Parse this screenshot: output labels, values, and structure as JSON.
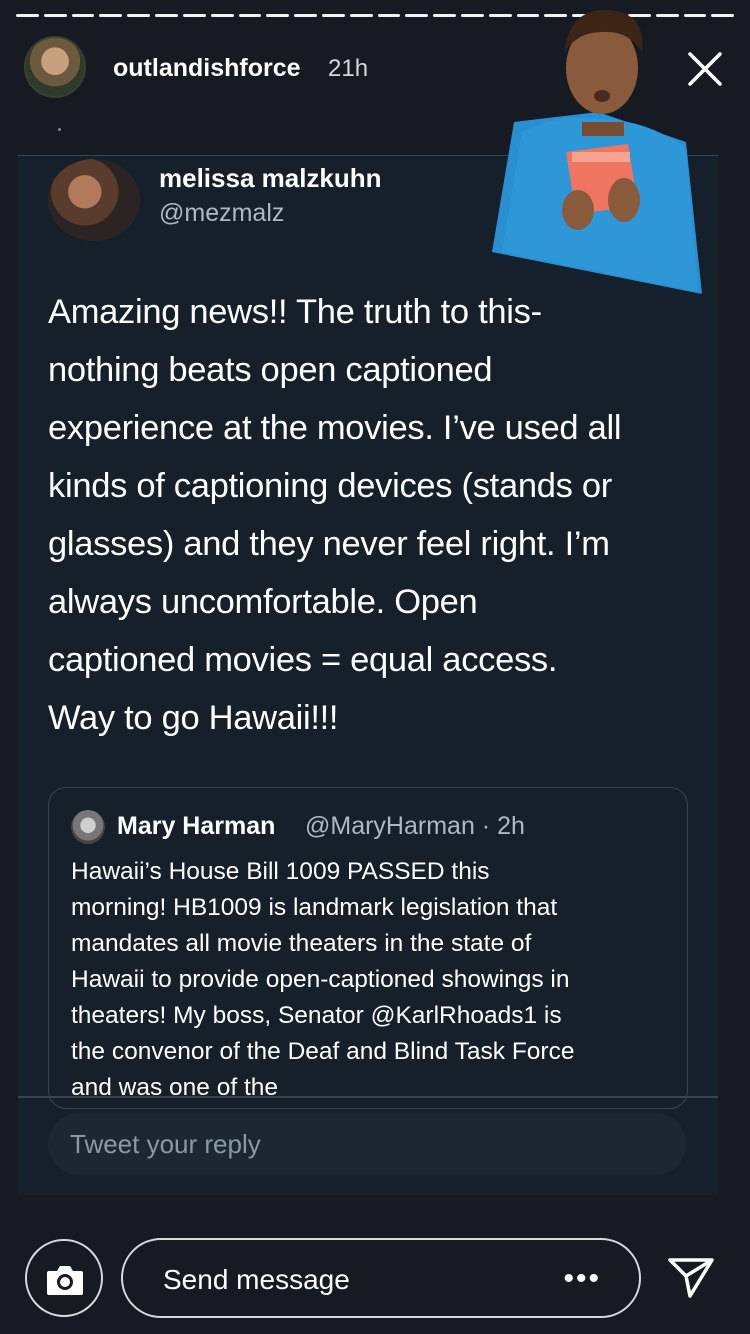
{
  "story": {
    "progress_segments": 26,
    "progress_done": 26,
    "username": "outlandishforce",
    "time": "21h"
  },
  "tweet": {
    "author_name": "melissa malzkuhn",
    "author_handle": "@mezmalz",
    "lines": [
      "Amazing news!!  The truth to this-",
      "nothing beats open captioned",
      "experience at the movies.  I’ve used all",
      "kinds of captioning devices (stands or",
      "glasses) and they never feel right. I’m",
      "always uncomfortable. Open",
      "captioned movies = equal access.",
      "Way to go Hawaii!!!"
    ],
    "quote": {
      "name": "Mary Harman",
      "handle_time": "@MaryHarman · 2h",
      "lines": [
        "Hawaii’s House Bill 1009 PASSED this",
        "morning!  HB1009 is landmark legislation that",
        "mandates all movie theaters in the state of",
        "Hawaii to provide open-captioned showings in",
        "theaters!  My boss, Senator @KarlRhoads1 is",
        "the convenor of the Deaf and Blind Task Force",
        "and was one of the"
      ]
    },
    "reply_placeholder": "Tweet your reply"
  },
  "bottom": {
    "send_placeholder": "Send message",
    "more_label": "•••"
  },
  "colors": {
    "background": "#161a22",
    "card": "#15202b",
    "muted": "#aeb8c2",
    "border": "#38444d"
  },
  "icons": [
    "close-icon",
    "camera-icon",
    "more-icon",
    "send-icon"
  ]
}
